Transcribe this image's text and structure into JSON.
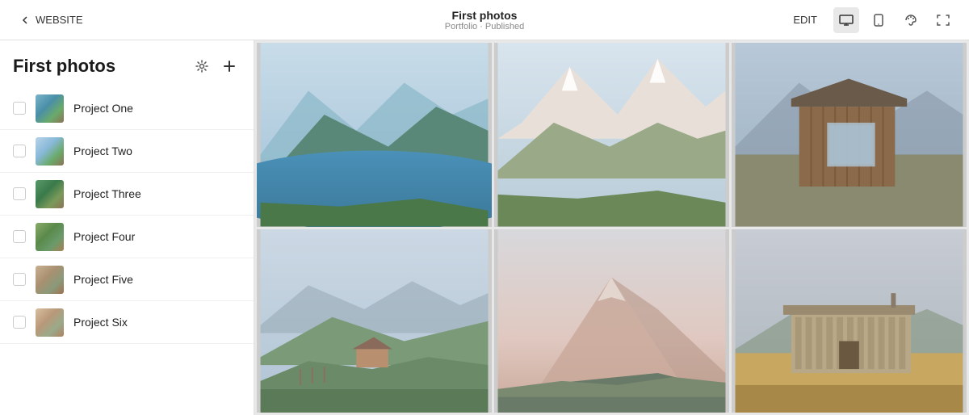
{
  "header": {
    "website_label": "WEBSITE",
    "edit_label": "EDIT",
    "page_title": "First photos",
    "page_subtitle": "Portfolio · Published"
  },
  "sidebar": {
    "title": "First photos",
    "projects": [
      {
        "id": 1,
        "name": "Project One",
        "thumb_class": "thumb-1"
      },
      {
        "id": 2,
        "name": "Project Two",
        "thumb_class": "thumb-2"
      },
      {
        "id": 3,
        "name": "Project Three",
        "thumb_class": "thumb-3"
      },
      {
        "id": 4,
        "name": "Project Four",
        "thumb_class": "thumb-4"
      },
      {
        "id": 5,
        "name": "Project Five",
        "thumb_class": "thumb-5"
      },
      {
        "id": 6,
        "name": "Project Six",
        "thumb_class": "thumb-6"
      }
    ]
  },
  "photos": [
    {
      "id": 1,
      "scene": "scene-mountain-lake",
      "alt": "Mountain lake landscape"
    },
    {
      "id": 2,
      "scene": "scene-mountain-range",
      "alt": "Mountain range"
    },
    {
      "id": 3,
      "scene": "scene-barn",
      "alt": "Barn building"
    },
    {
      "id": 4,
      "scene": "scene-hills",
      "alt": "Rolling hills"
    },
    {
      "id": 5,
      "scene": "scene-pink-mountain",
      "alt": "Pink mountain sunset"
    },
    {
      "id": 6,
      "scene": "scene-modern-building",
      "alt": "Modern building"
    }
  ]
}
